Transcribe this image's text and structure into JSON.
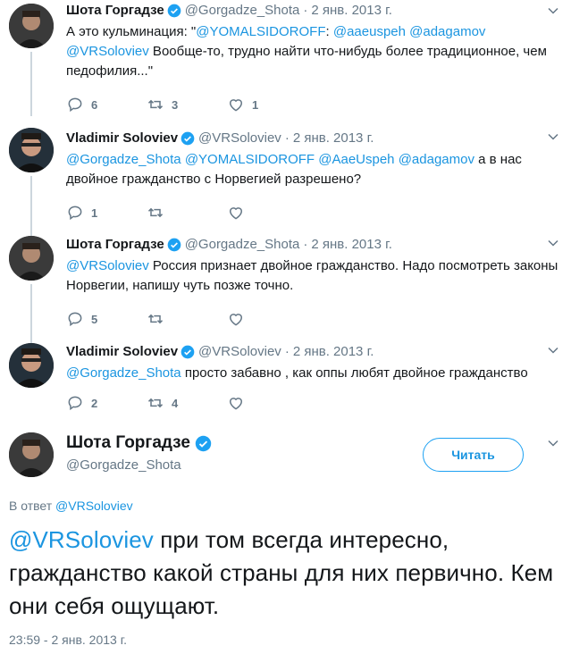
{
  "colors": {
    "accent": "#1da1f2",
    "link": "#1b95e0",
    "muted": "#657786",
    "line": "#ccd6dd"
  },
  "tweets": [
    {
      "name": "Шота Горгадзе",
      "handle": "@Gorgadze_Shota",
      "date": "2 янв. 2013 г.",
      "text_parts": [
        {
          "t": "А это кульминация: \"",
          "m": false
        },
        {
          "t": "@YOMALSIDOROFF",
          "m": true
        },
        {
          "t": ": ",
          "m": false
        },
        {
          "t": "@aaeuspeh",
          "m": true
        },
        {
          "t": " ",
          "m": false
        },
        {
          "t": "@adagamov",
          "m": true
        },
        {
          "t": " ",
          "m": false
        },
        {
          "t": "@VRSoloviev",
          "m": true
        },
        {
          "t": " Вообще-то, трудно найти что-нибудь более традиционное, чем педофилия...\"",
          "m": false
        }
      ],
      "replies": "6",
      "retweets": "3",
      "likes": "1"
    },
    {
      "name": "Vladimir Soloviev",
      "handle": "@VRSoloviev",
      "date": "2 янв. 2013 г.",
      "text_parts": [
        {
          "t": "@Gorgadze_Shota",
          "m": true
        },
        {
          "t": " ",
          "m": false
        },
        {
          "t": "@YOMALSIDOROFF",
          "m": true
        },
        {
          "t": " ",
          "m": false
        },
        {
          "t": "@AaeUspeh",
          "m": true
        },
        {
          "t": " ",
          "m": false
        },
        {
          "t": "@adagamov",
          "m": true
        },
        {
          "t": " а в нас двойное гражданство с Норвегией разрешено?",
          "m": false
        }
      ],
      "replies": "1",
      "retweets": "",
      "likes": ""
    },
    {
      "name": "Шота Горгадзе",
      "handle": "@Gorgadze_Shota",
      "date": "2 янв. 2013 г.",
      "text_parts": [
        {
          "t": "@VRSoloviev",
          "m": true
        },
        {
          "t": " Россия признает двойное гражданство. Надо посмотреть законы Норвегии, напишу чуть позже точно.",
          "m": false
        }
      ],
      "replies": "5",
      "retweets": "",
      "likes": ""
    },
    {
      "name": "Vladimir Soloviev",
      "handle": "@VRSoloviev",
      "date": "2 янв. 2013 г.",
      "text_parts": [
        {
          "t": "@Gorgadze_Shota",
          "m": true
        },
        {
          "t": " просто забавно , как оппы любят двойное гражданство",
          "m": false
        }
      ],
      "replies": "2",
      "retweets": "4",
      "likes": ""
    }
  ],
  "focused": {
    "name": "Шота Горгадзе",
    "handle": "@Gorgadze_Shota",
    "follow_label": "Читать",
    "reply_prefix": "В ответ ",
    "reply_handle": "@VRSoloviev",
    "text_mention": "@VRSoloviev",
    "text_body": " при том всегда интересно, гражданство какой страны для них первично. Кем они себя ощущают.",
    "time": "23:59 - 2 янв. 2013 г."
  }
}
